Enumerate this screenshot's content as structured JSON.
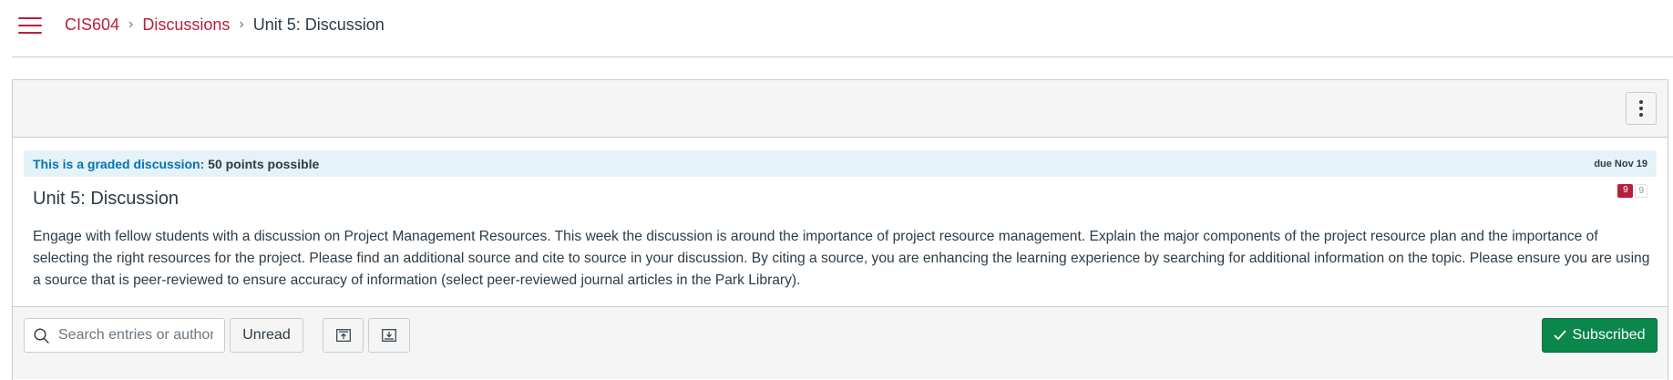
{
  "header": {
    "breadcrumb": {
      "course": "CIS604",
      "section": "Discussions",
      "current": "Unit 5: Discussion",
      "separator": "›"
    }
  },
  "discussion": {
    "graded_label": "This is a graded discussion:",
    "graded_points": "50 points possible",
    "due": "due Nov 19",
    "title": "Unit 5: Discussion",
    "unread_count": "9",
    "total_count": "9",
    "body": "Engage with fellow students with a discussion on Project Management Resources.  This week the discussion is around the importance of project resource management.  Explain the major components of the project resource plan and the importance of selecting the right resources for the project.  Please find an additional source and cite to source in your discussion.  By citing a source, you are enhancing the learning experience by searching for additional information on the topic.  Please ensure you are using a source that is peer-reviewed to ensure accuracy of information (select peer-reviewed journal articles in the Park Library)."
  },
  "toolbar": {
    "search_placeholder": "Search entries or author",
    "unread_label": "Unread",
    "subscribed_label": "Subscribed"
  },
  "icons": {
    "menu": "hamburger-icon",
    "options": "kebab-icon",
    "search": "search-icon",
    "collapse": "collapse-replies-icon",
    "expand": "expand-replies-icon",
    "check": "checkmark-icon"
  },
  "colors": {
    "brand": "#b7203d",
    "link_blue": "#0374b5",
    "graded_bg": "#e5f2f8",
    "subscribed_green": "#0b874b"
  }
}
